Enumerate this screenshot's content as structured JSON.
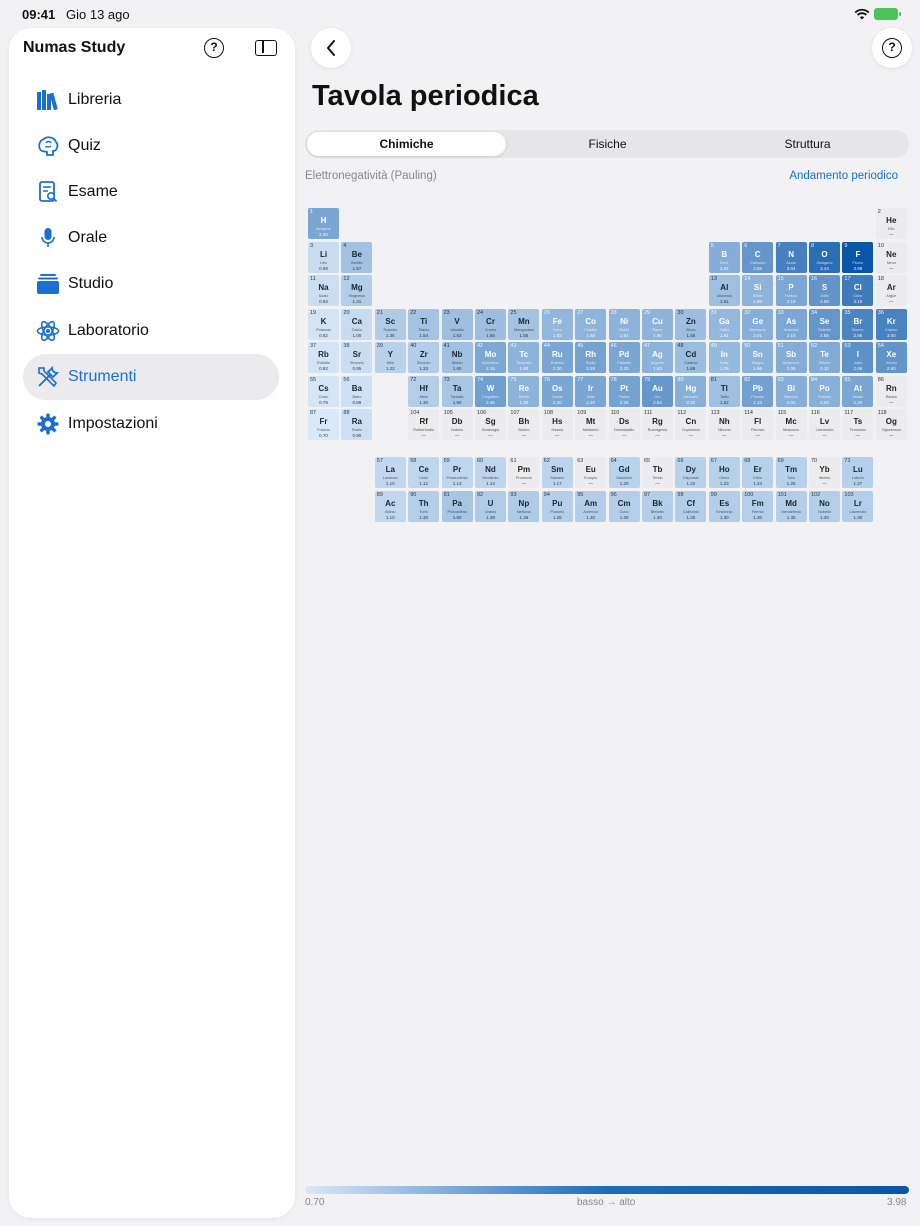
{
  "status": {
    "time": "09:41",
    "date": "Gio 13 ago"
  },
  "sidebar": {
    "app_title": "Numas Study",
    "help": "?",
    "items": [
      {
        "label": "Libreria",
        "icon": "books-icon"
      },
      {
        "label": "Quiz",
        "icon": "brain-icon"
      },
      {
        "label": "Esame",
        "icon": "exam-icon"
      },
      {
        "label": "Orale",
        "icon": "microphone-icon"
      },
      {
        "label": "Studio",
        "icon": "stack-icon"
      },
      {
        "label": "Laboratorio",
        "icon": "atom-icon"
      },
      {
        "label": "Strumenti",
        "icon": "tools-icon",
        "active": true
      },
      {
        "label": "Impostazioni",
        "icon": "gear-icon"
      }
    ]
  },
  "main": {
    "help": "?",
    "title": "Tavola periodica",
    "tabs": [
      "Chimiche",
      "Fisiche",
      "Struttura"
    ],
    "active_tab": "Chimiche",
    "property_label": "Elettronegatività (Pauling)",
    "trend_link": "Andamento periodico",
    "legend": {
      "min": "0.70",
      "mid": "basso → alto",
      "max": "3.98"
    },
    "colors": {
      "accent": "#1a6fd1",
      "scale_low": "#d8e8f7",
      "scale_high": "#0a56a8",
      "empty": "#ececee"
    }
  },
  "elements": [
    [
      1,
      "H",
      "Idrogeno",
      "2.20",
      1,
      1
    ],
    [
      2,
      "He",
      "Elio",
      "—",
      1,
      18
    ],
    [
      3,
      "Li",
      "Litio",
      "0.98",
      2,
      1
    ],
    [
      4,
      "Be",
      "Berillio",
      "1.57",
      2,
      2
    ],
    [
      5,
      "B",
      "Boro",
      "2.04",
      2,
      13
    ],
    [
      6,
      "C",
      "Carbonio",
      "2.55",
      2,
      14
    ],
    [
      7,
      "N",
      "Azoto",
      "3.04",
      2,
      15
    ],
    [
      8,
      "O",
      "Ossigeno",
      "3.44",
      2,
      16
    ],
    [
      9,
      "F",
      "Fluoro",
      "3.98",
      2,
      17
    ],
    [
      10,
      "Ne",
      "Neon",
      "—",
      2,
      18
    ],
    [
      11,
      "Na",
      "Sodio",
      "0.93",
      3,
      1
    ],
    [
      12,
      "Mg",
      "Magnesio",
      "1.31",
      3,
      2
    ],
    [
      13,
      "Al",
      "Alluminio",
      "1.61",
      3,
      13
    ],
    [
      14,
      "Si",
      "Silicio",
      "1.90",
      3,
      14
    ],
    [
      15,
      "P",
      "Fosforo",
      "2.19",
      3,
      15
    ],
    [
      16,
      "S",
      "Zolfo",
      "2.58",
      3,
      16
    ],
    [
      17,
      "Cl",
      "Cloro",
      "3.16",
      3,
      17
    ],
    [
      18,
      "Ar",
      "Argon",
      "—",
      3,
      18
    ],
    [
      19,
      "K",
      "Potassio",
      "0.82",
      4,
      1
    ],
    [
      20,
      "Ca",
      "Calcio",
      "1.00",
      4,
      2
    ],
    [
      21,
      "Sc",
      "Scandio",
      "1.36",
      4,
      3
    ],
    [
      22,
      "Ti",
      "Titanio",
      "1.54",
      4,
      4
    ],
    [
      23,
      "V",
      "Vanadio",
      "1.63",
      4,
      5
    ],
    [
      24,
      "Cr",
      "Cromo",
      "1.66",
      4,
      6
    ],
    [
      25,
      "Mn",
      "Manganese",
      "1.55",
      4,
      7
    ],
    [
      26,
      "Fe",
      "Ferro",
      "1.83",
      4,
      8
    ],
    [
      27,
      "Co",
      "Cobalto",
      "1.88",
      4,
      9
    ],
    [
      28,
      "Ni",
      "Nichel",
      "1.91",
      4,
      10
    ],
    [
      29,
      "Cu",
      "Rame",
      "1.90",
      4,
      11
    ],
    [
      30,
      "Zn",
      "Zinco",
      "1.65",
      4,
      12
    ],
    [
      31,
      "Ga",
      "Gallio",
      "1.81",
      4,
      13
    ],
    [
      32,
      "Ge",
      "Germanio",
      "2.01",
      4,
      14
    ],
    [
      33,
      "As",
      "Arsenico",
      "2.18",
      4,
      15
    ],
    [
      34,
      "Se",
      "Selenio",
      "2.55",
      4,
      16
    ],
    [
      35,
      "Br",
      "Bromo",
      "2.96",
      4,
      17
    ],
    [
      36,
      "Kr",
      "Kripton",
      "3.00",
      4,
      18
    ],
    [
      37,
      "Rb",
      "Rubidio",
      "0.82",
      5,
      1
    ],
    [
      38,
      "Sr",
      "Stronzio",
      "0.95",
      5,
      2
    ],
    [
      39,
      "Y",
      "Ittrio",
      "1.22",
      5,
      3
    ],
    [
      40,
      "Zr",
      "Zirconio",
      "1.33",
      5,
      4
    ],
    [
      41,
      "Nb",
      "Niobio",
      "1.60",
      5,
      5
    ],
    [
      42,
      "Mo",
      "Molibdeno",
      "2.16",
      5,
      6
    ],
    [
      43,
      "Tc",
      "Tecnezio",
      "1.90",
      5,
      7
    ],
    [
      44,
      "Ru",
      "Rutenio",
      "2.20",
      5,
      8
    ],
    [
      45,
      "Rh",
      "Rodio",
      "2.28",
      5,
      9
    ],
    [
      46,
      "Pd",
      "Palladio",
      "2.20",
      5,
      10
    ],
    [
      47,
      "Ag",
      "Argento",
      "1.93",
      5,
      11
    ],
    [
      48,
      "Cd",
      "Cadmio",
      "1.69",
      5,
      12
    ],
    [
      49,
      "In",
      "Indio",
      "1.78",
      5,
      13
    ],
    [
      50,
      "Sn",
      "Stagno",
      "1.96",
      5,
      14
    ],
    [
      51,
      "Sb",
      "Antimonio",
      "2.05",
      5,
      15
    ],
    [
      52,
      "Te",
      "Tellurio",
      "2.10",
      5,
      16
    ],
    [
      53,
      "I",
      "Iodio",
      "2.66",
      5,
      17
    ],
    [
      54,
      "Xe",
      "Xenon",
      "2.60",
      5,
      18
    ],
    [
      55,
      "Cs",
      "Cesio",
      "0.79",
      6,
      1
    ],
    [
      56,
      "Ba",
      "Bario",
      "0.89",
      6,
      2
    ],
    [
      72,
      "Hf",
      "Afnio",
      "1.30",
      6,
      4
    ],
    [
      73,
      "Ta",
      "Tantalio",
      "1.50",
      6,
      5
    ],
    [
      74,
      "W",
      "Tungsteno",
      "2.36",
      6,
      6
    ],
    [
      75,
      "Re",
      "Renio",
      "1.90",
      6,
      7
    ],
    [
      76,
      "Os",
      "Osmio",
      "2.20",
      6,
      8
    ],
    [
      77,
      "Ir",
      "Iridio",
      "2.20",
      6,
      9
    ],
    [
      78,
      "Pt",
      "Platino",
      "2.28",
      6,
      10
    ],
    [
      79,
      "Au",
      "Oro",
      "2.54",
      6,
      11
    ],
    [
      80,
      "Hg",
      "Mercurio",
      "2.00",
      6,
      12
    ],
    [
      81,
      "Tl",
      "Tallio",
      "1.62",
      6,
      13
    ],
    [
      82,
      "Pb",
      "Piombo",
      "2.33",
      6,
      14
    ],
    [
      83,
      "Bi",
      "Bismuto",
      "2.02",
      6,
      15
    ],
    [
      84,
      "Po",
      "Polonio",
      "2.00",
      6,
      16
    ],
    [
      85,
      "At",
      "Astato",
      "2.20",
      6,
      17
    ],
    [
      86,
      "Rn",
      "Radon",
      "—",
      6,
      18
    ],
    [
      87,
      "Fr",
      "Francio",
      "0.70",
      7,
      1
    ],
    [
      88,
      "Ra",
      "Radio",
      "0.90",
      7,
      2
    ],
    [
      104,
      "Rf",
      "Rutherfordio",
      "—",
      7,
      4
    ],
    [
      105,
      "Db",
      "Dubnio",
      "—",
      7,
      5
    ],
    [
      106,
      "Sg",
      "Seaborgio",
      "—",
      7,
      6
    ],
    [
      107,
      "Bh",
      "Bohrio",
      "—",
      7,
      7
    ],
    [
      108,
      "Hs",
      "Hassio",
      "—",
      7,
      8
    ],
    [
      109,
      "Mt",
      "Meitnerio",
      "—",
      7,
      9
    ],
    [
      110,
      "Ds",
      "Darmstadtio",
      "—",
      7,
      10
    ],
    [
      111,
      "Rg",
      "Roentgenio",
      "—",
      7,
      11
    ],
    [
      112,
      "Cn",
      "Copernicio",
      "—",
      7,
      12
    ],
    [
      113,
      "Nh",
      "Nihonio",
      "—",
      7,
      13
    ],
    [
      114,
      "Fl",
      "Flerovio",
      "—",
      7,
      14
    ],
    [
      115,
      "Mc",
      "Moscovio",
      "—",
      7,
      15
    ],
    [
      116,
      "Lv",
      "Livermorio",
      "—",
      7,
      16
    ],
    [
      117,
      "Ts",
      "Tennesso",
      "—",
      7,
      17
    ],
    [
      118,
      "Og",
      "Oganesson",
      "—",
      7,
      18
    ],
    [
      57,
      "La",
      "Lantanio",
      "1.10",
      9,
      3
    ],
    [
      58,
      "Ce",
      "Cerio",
      "1.12",
      9,
      4
    ],
    [
      59,
      "Pr",
      "Praseodimio",
      "1.13",
      9,
      5
    ],
    [
      60,
      "Nd",
      "Neodimio",
      "1.14",
      9,
      6
    ],
    [
      61,
      "Pm",
      "Promezio",
      "—",
      9,
      7
    ],
    [
      62,
      "Sm",
      "Samario",
      "1.17",
      9,
      8
    ],
    [
      63,
      "Eu",
      "Europio",
      "—",
      9,
      9
    ],
    [
      64,
      "Gd",
      "Gadolinio",
      "1.20",
      9,
      10
    ],
    [
      65,
      "Tb",
      "Terbio",
      "—",
      9,
      11
    ],
    [
      66,
      "Dy",
      "Disprosio",
      "1.22",
      9,
      12
    ],
    [
      67,
      "Ho",
      "Olmio",
      "1.23",
      9,
      13
    ],
    [
      68,
      "Er",
      "Erbio",
      "1.24",
      9,
      14
    ],
    [
      69,
      "Tm",
      "Tulio",
      "1.25",
      9,
      15
    ],
    [
      70,
      "Yb",
      "Itterbio",
      "—",
      9,
      16
    ],
    [
      71,
      "Lu",
      "Lutezio",
      "1.27",
      9,
      17
    ],
    [
      89,
      "Ac",
      "Attinio",
      "1.10",
      10,
      3
    ],
    [
      90,
      "Th",
      "Torio",
      "1.30",
      10,
      4
    ],
    [
      91,
      "Pa",
      "Protoattinio",
      "1.50",
      10,
      5
    ],
    [
      92,
      "U",
      "Uranio",
      "1.38",
      10,
      6
    ],
    [
      93,
      "Np",
      "Nettunio",
      "1.36",
      10,
      7
    ],
    [
      94,
      "Pu",
      "Plutonio",
      "1.28",
      10,
      8
    ],
    [
      95,
      "Am",
      "Americio",
      "1.30",
      10,
      9
    ],
    [
      96,
      "Cm",
      "Curio",
      "1.30",
      10,
      10
    ],
    [
      97,
      "Bk",
      "Berkelio",
      "1.30",
      10,
      11
    ],
    [
      98,
      "Cf",
      "Californio",
      "1.30",
      10,
      12
    ],
    [
      99,
      "Es",
      "Einsteinio",
      "1.30",
      10,
      13
    ],
    [
      100,
      "Fm",
      "Fermio",
      "1.30",
      10,
      14
    ],
    [
      101,
      "Md",
      "Mendelevio",
      "1.30",
      10,
      15
    ],
    [
      102,
      "No",
      "Nobelio",
      "1.30",
      10,
      16
    ],
    [
      103,
      "Lr",
      "Laurenzio",
      "1.30",
      10,
      17
    ]
  ]
}
